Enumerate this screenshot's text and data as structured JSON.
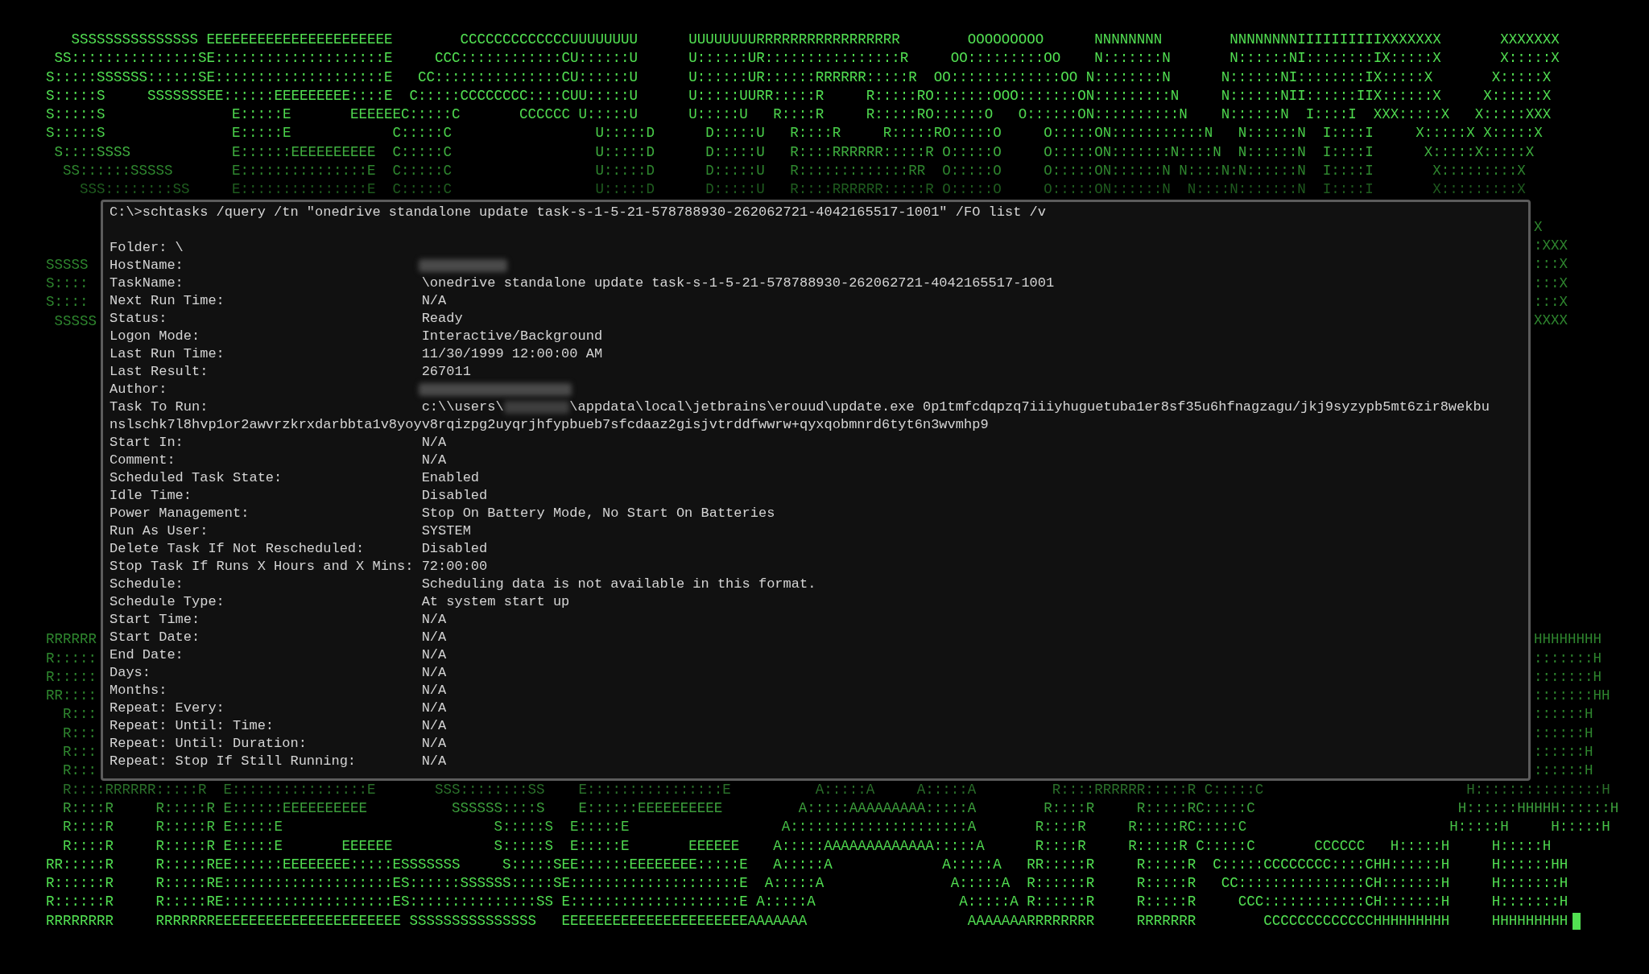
{
  "background_art": {
    "top_rows": [
      "   SSSSSSSSSSSSSSS EEEEEEEEEEEEEEEEEEEEEE        CCCCCCCCCCCCCUUUUUUUU      UUUUUUUURRRRRRRRRRRRRRRRR        OOOOOOOOO      NNNNNNNN        NNNNNNNNIIIIIIIIIIXXXXXXX       XXXXXXX",
      " SS:::::::::::::::SE::::::::::::::::::::E     CCC::::::::::::CU::::::U      U::::::UR::::::::::::::::R     OO:::::::::OO    N:::::::N       N::::::NI::::::::IX:::::X       X:::::X",
      "S:::::SSSSSS::::::SE::::::::::::::::::::E   CC:::::::::::::::CU::::::U      U::::::UR::::::RRRRRR:::::R  OO:::::::::::::OO N::::::::N      N::::::NI::::::::IX:::::X       X:::::X",
      "S:::::S     SSSSSSSEE::::::EEEEEEEEE::::E  C:::::CCCCCCCC::::CUU:::::U      U:::::UURR:::::R     R:::::RO:::::::OOO:::::::ON:::::::::N     N::::::NII::::::IIX::::::X     X::::::X",
      "S:::::S               E:::::E       EEEEEEC:::::C       CCCCCC U:::::U      U:::::U   R::::R     R:::::RO::::::O   O::::::ON::::::::::N    N::::::N  I::::I  XXX:::::X   X:::::XXX",
      "S:::::S               E:::::E            C:::::C                 U:::::D      D:::::U   R::::R     R:::::RO:::::O     O:::::ON:::::::::::N   N::::::N  I::::I     X:::::X X:::::X",
      " S::::SSSS            E::::::EEEEEEEEEE  C:::::C                 U:::::D      D:::::U   R::::RRRRRR:::::R O:::::O     O:::::ON:::::::N::::N  N::::::N  I::::I      X:::::X:::::X",
      "  SS::::::SSSSS       E:::::::::::::::E  C:::::C                 U:::::D      D:::::U   R:::::::::::::RR  O:::::O     O:::::ON::::::N N::::N:N::::::N  I::::I       X:::::::::X",
      "    SSS::::::::SS     E:::::::::::::::E  C:::::C                 U:::::D      D:::::U   R::::RRRRRR:::::R O:::::O     O:::::ON::::::N  N::::N:::::::N  I::::I       X:::::::::X"
    ],
    "left_upper": [
      "SSSSS",
      "S::::",
      "S::::",
      " SSSSS"
    ],
    "left_lower": [
      "RRRRRR",
      "R:::::",
      "R:::::",
      "RR::::",
      "  R:::",
      "  R:::",
      "  R:::",
      "  R:::"
    ],
    "right_upper": [
      "X",
      ":XXX",
      ":::X",
      ":::X",
      ":::X",
      "XXXX"
    ],
    "right_lower": [
      "HHHHHHHH",
      ":::::::H",
      ":::::::H",
      ":::::::HH",
      "::::::H",
      "::::::H",
      "::::::H",
      "::::::H"
    ],
    "bottom_rows": [
      "  R::::RRRRRR:::::R  E::::::::::::::::E       SSS::::::::SS    E::::::::::::::::E          A:::::A     A:::::A         R::::RRRRRR:::::R C:::::C                        H:::::::::::::::H",
      "  R::::R     R:::::R E::::::EEEEEEEEEE          SSSSSS::::S    E::::::EEEEEEEEEE         A:::::AAAAAAAAA:::::A        R::::R     R:::::RC:::::C                        H::::::HHHHH::::::H",
      "  R::::R     R:::::R E:::::E                         S:::::S  E:::::E                  A:::::::::::::::::::::A       R::::R     R:::::RC:::::C                        H:::::H     H:::::H",
      "  R::::R     R:::::R E:::::E       EEEEEE            S:::::S  E:::::E       EEEEEE    A:::::AAAAAAAAAAAAA:::::A      R::::R     R:::::R C:::::C       CCCCCC   H:::::H     H:::::H",
      "RR:::::R     R:::::REE::::::EEEEEEEE:::::ESSSSSSS     S:::::SEE::::::EEEEEEEE:::::E   A:::::A             A:::::A   RR:::::R     R:::::R  C:::::CCCCCCCC::::CHH::::::H     H::::::HH",
      "R::::::R     R:::::RE::::::::::::::::::::ES::::::SSSSSS:::::SE::::::::::::::::::::E  A:::::A               A:::::A  R::::::R     R:::::R   CC:::::::::::::::CH:::::::H     H:::::::H",
      "R::::::R     R:::::RE::::::::::::::::::::ES:::::::::::::::SS E::::::::::::::::::::E A:::::A                 A:::::A R::::::R     R:::::R     CCC::::::::::::CH:::::::H     H:::::::H",
      "RRRRRRRR     RRRRRRREEEEEEEEEEEEEEEEEEEEEE SSSSSSSSSSSSSSS   EEEEEEEEEEEEEEEEEEEEEEAAAAAAA                   AAAAAAARRRRRRRR     RRRRRRR        CCCCCCCCCCCCCHHHHHHHHH     HHHHHHHHH"
    ]
  },
  "terminal": {
    "command": "C:\\>schtasks /query /tn \"onedrive standalone update task-s-1-5-21-578788930-262062721-4042165517-1001\" /FO list /v",
    "rows": [
      {
        "kind": "inline",
        "label": "Folder:",
        "value": "\\"
      },
      {
        "kind": "redacted",
        "label": "HostName:"
      },
      {
        "kind": "value",
        "label": "TaskName:",
        "value": "\\onedrive standalone update task-s-1-5-21-578788930-262062721-4042165517-1001"
      },
      {
        "kind": "value",
        "label": "Next Run Time:",
        "value": "N/A"
      },
      {
        "kind": "value",
        "label": "Status:",
        "value": "Ready"
      },
      {
        "kind": "value",
        "label": "Logon Mode:",
        "value": "Interactive/Background"
      },
      {
        "kind": "value",
        "label": "Last Run Time:",
        "value": "11/30/1999 12:00:00 AM"
      },
      {
        "kind": "value",
        "label": "Last Result:",
        "value": "267011"
      },
      {
        "kind": "redacted",
        "label": "Author:"
      },
      {
        "kind": "redacted_path",
        "label": "Task To Run:",
        "value": "c:\\\\users\\",
        "value_after": "\\appdata\\local\\jetbrains\\erouud\\update.exe 0p1tmfcdqpzq7iiiyhuguetuba1er8sf35u6hfnagzagu/jkj9syzypb5mt6zir8wekbu",
        "continuation": "nslschk7l8hvp1or2awvrzkrxdarbbta1v8yoyv8rqizpg2uyqrjhfypbueb7sfcdaaz2gisjvtrddfwwrw+qyxqobmnrd6tyt6n3wvmhp9"
      },
      {
        "kind": "value",
        "label": "Start In:",
        "value": "N/A"
      },
      {
        "kind": "value",
        "label": "Comment:",
        "value": "N/A"
      },
      {
        "kind": "value",
        "label": "Scheduled Task State:",
        "value": "Enabled"
      },
      {
        "kind": "value",
        "label": "Idle Time:",
        "value": "Disabled"
      },
      {
        "kind": "value",
        "label": "Power Management:",
        "value": "Stop On Battery Mode, No Start On Batteries"
      },
      {
        "kind": "value",
        "label": "Run As User:",
        "value": "SYSTEM"
      },
      {
        "kind": "value",
        "label": "Delete Task If Not Rescheduled:",
        "value": "Disabled"
      },
      {
        "kind": "value",
        "label": "Stop Task If Runs X Hours and X Mins:",
        "value": "72:00:00"
      },
      {
        "kind": "value",
        "label": "Schedule:",
        "value": "Scheduling data is not available in this format."
      },
      {
        "kind": "value",
        "label": "Schedule Type:",
        "value": "At system start up"
      },
      {
        "kind": "value",
        "label": "Start Time:",
        "value": "N/A"
      },
      {
        "kind": "value",
        "label": "Start Date:",
        "value": "N/A"
      },
      {
        "kind": "value",
        "label": "End Date:",
        "value": "N/A"
      },
      {
        "kind": "value",
        "label": "Days:",
        "value": "N/A"
      },
      {
        "kind": "value",
        "label": "Months:",
        "value": "N/A"
      },
      {
        "kind": "value",
        "label": "Repeat: Every:",
        "value": "N/A"
      },
      {
        "kind": "value",
        "label": "Repeat: Until: Time:",
        "value": "N/A"
      },
      {
        "kind": "value",
        "label": "Repeat: Until: Duration:",
        "value": "N/A"
      },
      {
        "kind": "value",
        "label": "Repeat: Stop If Still Running:",
        "value": "N/A"
      }
    ]
  }
}
